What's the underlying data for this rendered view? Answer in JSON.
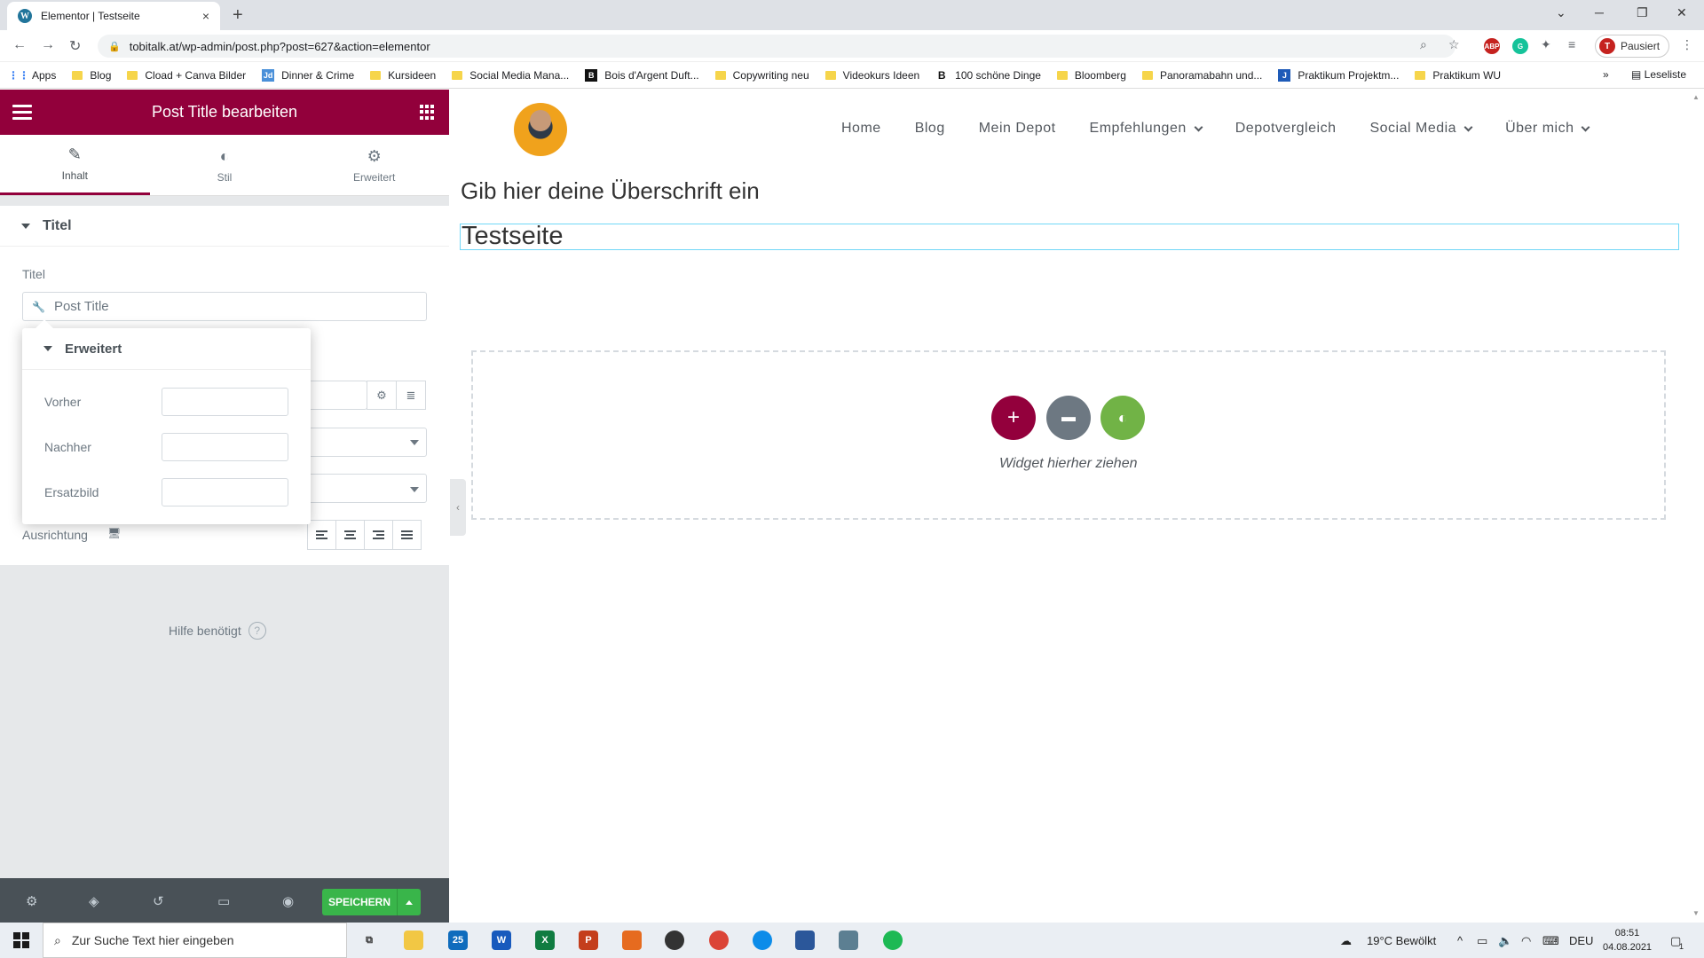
{
  "browser": {
    "tab_title": "Elementor | Testseite",
    "wp_glyph": "W",
    "new_tab": "+",
    "tab_close": "×",
    "url": "tobitalk.at/wp-admin/post.php?post=627&action=elementor",
    "profile_initial": "T",
    "profile_status": "Pausiert",
    "bookmarks": [
      "Apps",
      "Blog",
      "Cload + Canva Bilder",
      "Dinner & Crime",
      "Kursideen",
      "Social Media Mana...",
      "Bois d'Argent Duft...",
      "Copywriting neu",
      "Videokurs Ideen",
      "100 schöne Dinge",
      "Bloomberg",
      "Panoramabahn und...",
      "Praktikum Projektm...",
      "Praktikum WU"
    ],
    "bookmark_overflow": "»",
    "reading_list": "Leseliste"
  },
  "panel": {
    "title": "Post Title bearbeiten",
    "tabs": [
      "Inhalt",
      "Stil",
      "Erweitert"
    ],
    "section_title": "Titel",
    "title_label": "Titel",
    "title_value": "Post Title",
    "popover": {
      "title": "Erweitert",
      "fields": [
        "Vorher",
        "Nachher",
        "Ersatzbild"
      ]
    },
    "alignment_label": "Ausrichtung",
    "help": "Hilfe benötigt",
    "help_icon": "?",
    "save": "SPEICHERN"
  },
  "site": {
    "nav": [
      "Home",
      "Blog",
      "Mein Depot",
      "Empfehlungen",
      "Depotvergleich",
      "Social Media",
      "Über mich"
    ],
    "heading": "Gib hier deine Überschrift ein",
    "post_title": "Testseite",
    "drop_text": "Widget hierher ziehen",
    "buttons": {
      "add": "+",
      "template": "▬",
      "kit": "◐"
    },
    "colors": {
      "add": "#93003c",
      "template": "#6d7882",
      "kit": "#71b346"
    }
  },
  "taskbar": {
    "search_placeholder": "Zur Suche Text hier eingeben",
    "weather": "19°C  Bewölkt",
    "language": "DEU",
    "time": "08:51",
    "date": "04.08.2021",
    "mail_badge": "25",
    "notification_count": "1"
  },
  "colors": {
    "accent": "#92003b",
    "save_green": "#39b54a",
    "panel_bg": "#e6e8ea"
  }
}
